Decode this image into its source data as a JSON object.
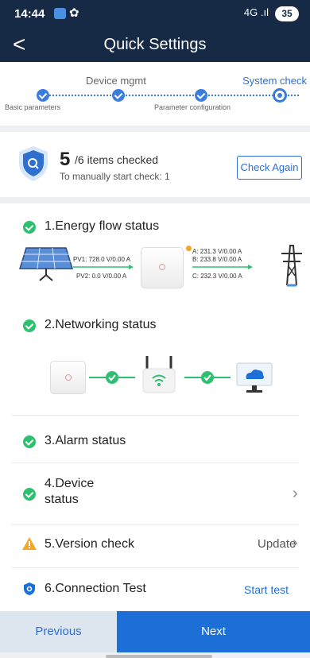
{
  "status_bar": {
    "time": "14:44",
    "signal": "4G .ıl",
    "battery": "35"
  },
  "nav": {
    "title": "Quick Settings"
  },
  "steps": [
    {
      "label": "Basic parameters",
      "state": "done"
    },
    {
      "label": "Device mgmt",
      "state": "done"
    },
    {
      "label": "Parameter configuration",
      "state": "done"
    },
    {
      "label": "System check",
      "state": "current"
    }
  ],
  "summary": {
    "count": "5",
    "count_rest": "/6 items checked",
    "sub": "To manually start check: 1",
    "check_again": "Check Again"
  },
  "checks": {
    "energy": {
      "title": "1.Energy flow status",
      "pv1": "PV1: 728.0 V/0.00 A",
      "pv2": "PV2: 0.0 V/0.00 A",
      "phase_a": "A: 231.3 V/0.00 A",
      "phase_b": "B: 233.8 V/0.00 A",
      "phase_c": "C: 232.3 V/0.00 A"
    },
    "network": {
      "title": "2.Networking status"
    },
    "alarm": {
      "title": "3.Alarm status"
    },
    "device": {
      "title_line1": "4.Device",
      "title_line2": "status"
    },
    "version": {
      "title": "5.Version check",
      "action": "Update"
    },
    "connection": {
      "title": "6.Connection Test",
      "action": "Start test"
    }
  },
  "footer": {
    "previous": "Previous",
    "next": "Next"
  },
  "colors": {
    "header": "#172a45",
    "accent": "#1b6fd6",
    "ok": "#2fbf71",
    "warn": "#f5a623"
  }
}
